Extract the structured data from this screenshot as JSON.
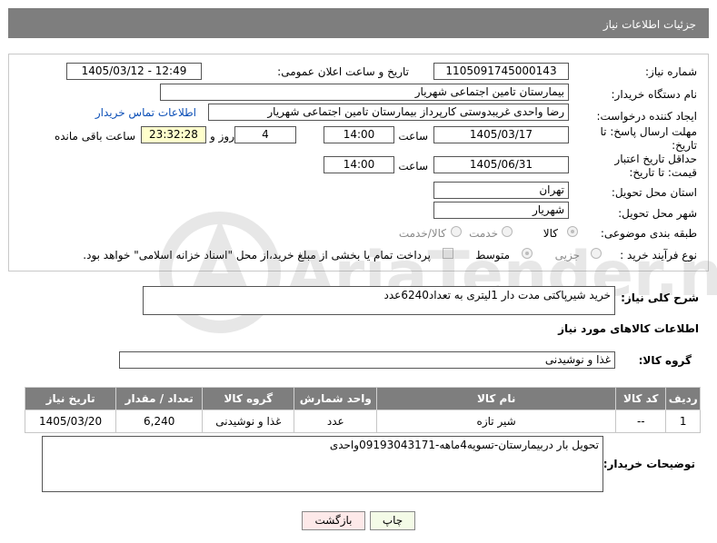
{
  "header": {
    "title": "جزئیات اطلاعات نیاز"
  },
  "form": {
    "need_number_label": "شماره نیاز:",
    "need_number": "1105091745000143",
    "announce_label": "تاریخ و ساعت اعلان عمومی:",
    "announce_value": "1405/03/12 - 12:49",
    "buyer_org_label": "نام دستگاه خریدار:",
    "buyer_org": "بیمارستان تامین اجتماعی شهریار",
    "creator_label": "ایجاد کننده درخواست:",
    "creator": "رضا واحدی غریبدوستی کارپرداز بیمارستان تامین اجتماعی شهریار",
    "contact_link": "اطلاعات تماس خریدار",
    "reply_deadline_label": "مهلت ارسال پاسخ: تا تاریخ:",
    "reply_date": "1405/03/17",
    "time_label": "ساعت",
    "reply_time": "14:00",
    "days_value": "4",
    "days_label": "روز و",
    "remaining_time": "23:32:28",
    "remaining_label": "ساعت باقی مانده",
    "validity_label": "حداقل تاریخ اعتبار قیمت: تا تاریخ:",
    "validity_date": "1405/06/31",
    "validity_time": "14:00",
    "province_label": "استان محل تحویل:",
    "province": "تهران",
    "city_label": "شهر محل تحویل:",
    "city": "شهریار",
    "category_label": "طبقه بندی موضوعی:",
    "category_options": [
      "کالا",
      "خدمت",
      "کالا/خدمت"
    ],
    "purchase_type_label": "نوع فرآیند خرید :",
    "purchase_options": [
      "جزیی",
      "متوسط"
    ],
    "payment_note": "پرداخت تمام یا بخشی از مبلغ خرید،از محل \"اسناد خزانه اسلامی\" خواهد بود."
  },
  "description": {
    "label": "شرح کلی نیاز:",
    "value": "خرید شیرپاکتی مدت دار 1لیتری به تعداد6240عدد"
  },
  "goods_section_title": "اطلاعات کالاهای مورد نیاز",
  "goods_group": {
    "label": "گروه کالا:",
    "value": "غذا و نوشیدنی"
  },
  "table": {
    "headers": [
      "ردیف",
      "کد کالا",
      "نام کالا",
      "واحد شمارش",
      "گروه کالا",
      "تعداد / مقدار",
      "تاریخ نیاز"
    ],
    "rows": [
      [
        "1",
        "--",
        "شیر تازه",
        "عدد",
        "غذا و نوشیدنی",
        "6,240",
        "1405/03/20"
      ]
    ]
  },
  "buyer_notes": {
    "label": "توضیحات خریدار:",
    "value": "تحویل بار دربیمارستان-تسویه4ماهه-09193043171واحدی"
  },
  "buttons": {
    "print": "چاپ",
    "back": "بازگشت"
  },
  "watermark": {
    "text": "AriaTender.net"
  }
}
